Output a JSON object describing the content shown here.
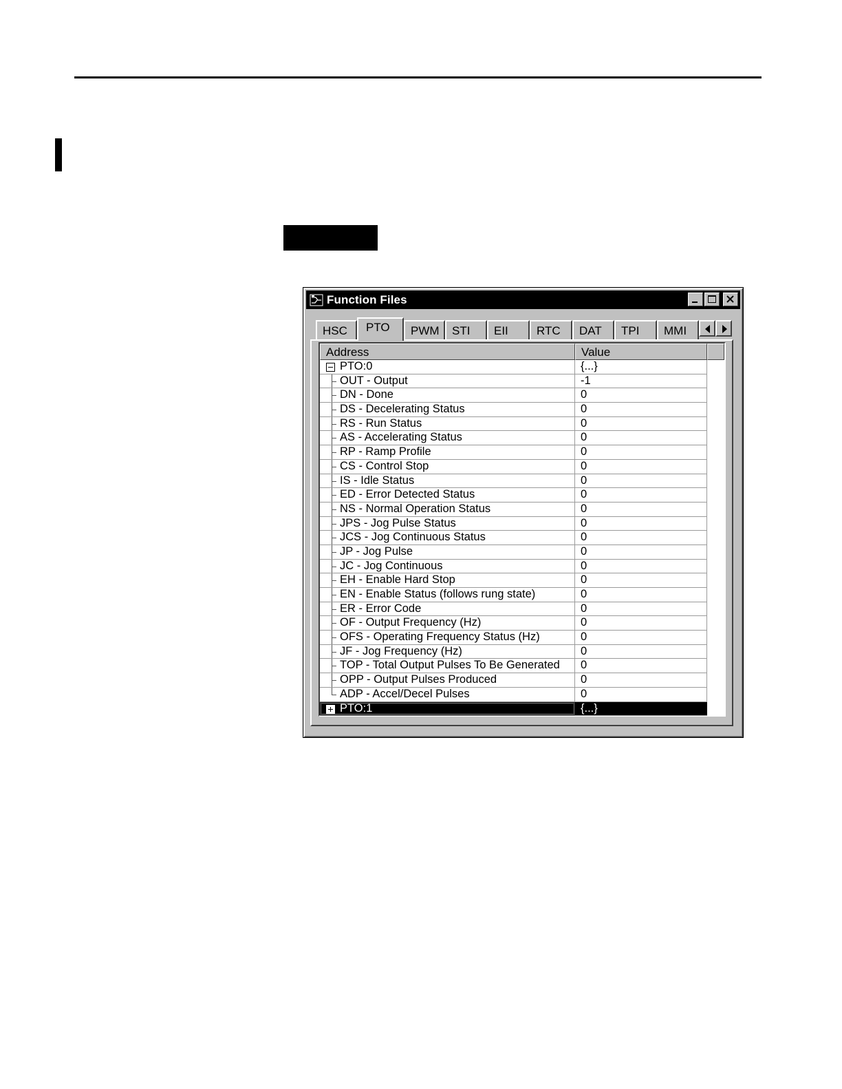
{
  "window": {
    "title": "Function Files",
    "tabs": [
      "HSC",
      "PTO",
      "PWM",
      "STI",
      "EII",
      "RTC",
      "DAT",
      "TPI",
      "MMI"
    ],
    "active_tab": "PTO"
  },
  "grid": {
    "headers": {
      "address": "Address",
      "value": "Value"
    },
    "parent": {
      "label": "PTO:0",
      "value": "{...}"
    },
    "rows": [
      {
        "label": "OUT - Output",
        "value": "-1"
      },
      {
        "label": "DN - Done",
        "value": "0"
      },
      {
        "label": "DS - Decelerating Status",
        "value": "0"
      },
      {
        "label": "RS - Run Status",
        "value": "0"
      },
      {
        "label": "AS - Accelerating Status",
        "value": "0"
      },
      {
        "label": "RP - Ramp Profile",
        "value": "0"
      },
      {
        "label": "CS - Control Stop",
        "value": "0"
      },
      {
        "label": "IS - Idle Status",
        "value": "0"
      },
      {
        "label": "ED - Error Detected Status",
        "value": "0"
      },
      {
        "label": "NS - Normal Operation Status",
        "value": "0"
      },
      {
        "label": "JPS - Jog Pulse Status",
        "value": "0"
      },
      {
        "label": "JCS - Jog Continuous Status",
        "value": "0"
      },
      {
        "label": "JP - Jog Pulse",
        "value": "0"
      },
      {
        "label": "JC - Jog Continuous",
        "value": "0"
      },
      {
        "label": "EH - Enable Hard Stop",
        "value": "0"
      },
      {
        "label": "EN - Enable Status (follows rung state)",
        "value": "0"
      },
      {
        "label": "ER - Error Code",
        "value": "0"
      },
      {
        "label": "OF - Output Frequency (Hz)",
        "value": "0"
      },
      {
        "label": "OFS - Operating Frequency Status (Hz)",
        "value": "0"
      },
      {
        "label": "JF - Jog Frequency (Hz)",
        "value": "0"
      },
      {
        "label": "TOP - Total Output Pulses To Be Generated",
        "value": "0"
      },
      {
        "label": "OPP - Output Pulses Produced",
        "value": "0"
      },
      {
        "label": "ADP - Accel/Decel Pulses",
        "value": "0"
      }
    ],
    "collapsed": {
      "label": "PTO:1",
      "value": "{...}"
    }
  }
}
